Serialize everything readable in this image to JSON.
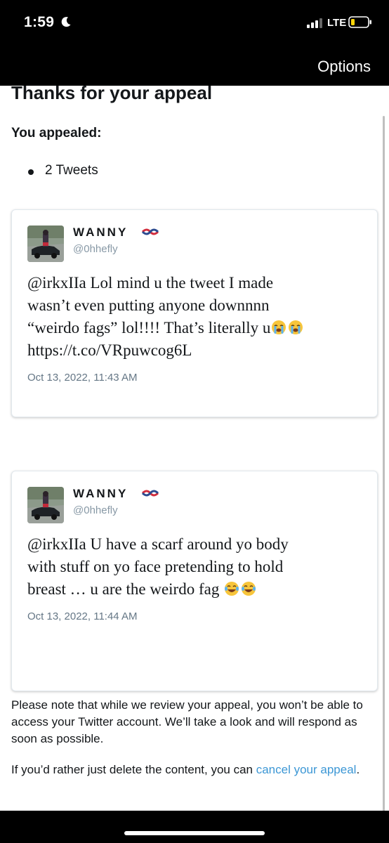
{
  "status_bar": {
    "time": "1:59",
    "network": "LTE"
  },
  "nav": {
    "options_label": "Options"
  },
  "page": {
    "title": "Thanks for your appeal",
    "appealed_label": "You appealed:",
    "appealed_items": [
      "2 Tweets"
    ]
  },
  "tweets": [
    {
      "name": "WANNY",
      "handle": "@0hhefly",
      "text_lines": [
        "@irkxIIa Lol mind u the tweet I made",
        "wasn’t even putting anyone downnnn",
        "“weirdo fags” lol!!!! That’s literally u",
        "https://t.co/VRpuwcog6L"
      ],
      "emojis": [
        "loudly-crying-face-icon",
        "loudly-crying-face-icon"
      ],
      "date": "Oct 13, 2022, 11:43 AM"
    },
    {
      "name": "WANNY",
      "handle": "@0hhefly",
      "text_lines": [
        "@irkxIIa U have a scarf around yo body",
        "with stuff on yo face pretending to hold",
        "breast … u are the weirdo fag"
      ],
      "emojis": [
        "tears-of-joy-face-icon",
        "tears-of-joy-face-icon"
      ],
      "date": "Oct 13, 2022, 11:44 AM"
    }
  ],
  "notice": {
    "review_text": "Please note that while we review your appeal, you won’t be able to access your Twitter account. We’ll take a look and will respond as soon as possible.",
    "delete_prefix": "If you’d rather just delete the content, you can ",
    "cancel_link": "cancel your appeal",
    "delete_suffix": "."
  },
  "colors": {
    "link": "#3c97d5",
    "text": "#14171a",
    "muted": "#657786",
    "handle": "#8899a6"
  }
}
